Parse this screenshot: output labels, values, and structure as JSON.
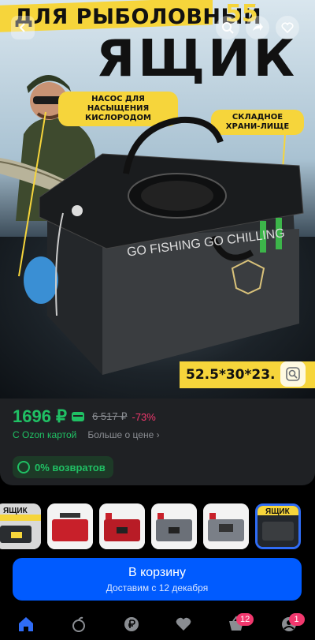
{
  "hero": {
    "banner_text": "ДЛЯ РЫБОЛОВНЫЙ",
    "size_badge": "55",
    "title": "ЯЩИК",
    "callout_pump": "НАСОС ДЛЯ НАСЫЩЕНИЯ КИСЛОРОДОМ",
    "callout_storage": "СКЛАДНОЕ ХРАНИ-ЛИЩЕ",
    "lid_print": "GO FISHING GO CHILLING",
    "dimensions": "52.5*30*23."
  },
  "product": {
    "price": "1696 ₽",
    "old_price": "6 517 ₽",
    "discount": "-73%",
    "ozon_card_text": "С Ozon картой",
    "more_price_text": "Больше о цене",
    "returns_text": "0% возвратов"
  },
  "thumbnails": {
    "t1_text": "ЯЩИК",
    "t6_text": "ЯЩИК"
  },
  "cart": {
    "label": "В корзину",
    "delivery": "Доставим с 12 декабря"
  },
  "nav": {
    "cart_badge": "12",
    "profile_badge": "1"
  },
  "colors": {
    "accent_green": "#20c064",
    "discount_pink": "#f2386e",
    "cart_blue": "#005bff",
    "banner_yellow": "#f6d53b"
  }
}
